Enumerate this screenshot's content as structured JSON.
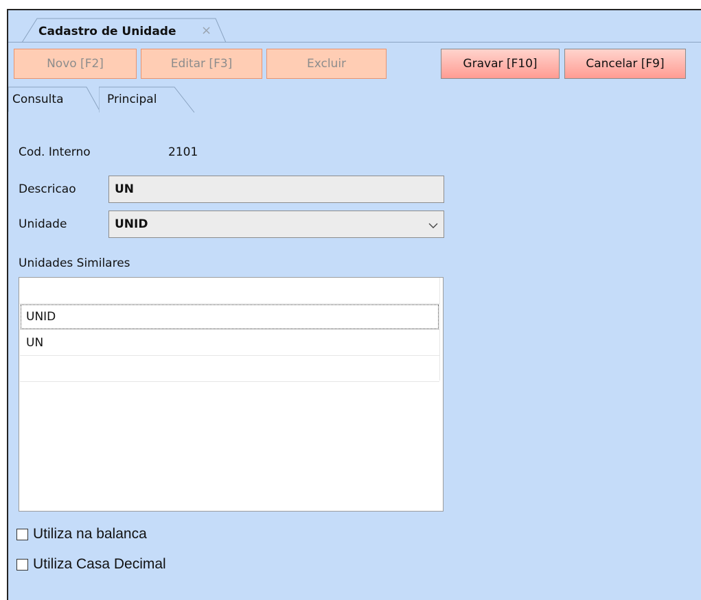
{
  "window_tab": {
    "title": "Cadastro de Unidade",
    "close_glyph": "×"
  },
  "toolbar": {
    "novo": "Novo [F2]",
    "editar": "Editar [F3]",
    "excluir": "Excluir",
    "gravar": "Gravar [F10]",
    "cancelar": "Cancelar [F9]"
  },
  "tabs": {
    "consulta": "Consulta",
    "principal": "Principal"
  },
  "form": {
    "cod_interno_label": "Cod. Interno",
    "cod_interno_value": "2101",
    "descricao_label": "Descricao",
    "descricao_value": "UN",
    "unidade_label": "Unidade",
    "unidade_value": "UNID",
    "similares_label": "Unidades Similares",
    "similares_rows": [
      "UNID",
      "UN"
    ]
  },
  "checkboxes": {
    "balanca": {
      "label": "Utiliza na balanca",
      "checked": false
    },
    "casa_decimal": {
      "label": "Utiliza Casa Decimal",
      "checked": false
    }
  },
  "colors": {
    "background": "#c5dcf9",
    "button_disabled": "#ffcdb4",
    "button_active": "#ff9c93"
  }
}
